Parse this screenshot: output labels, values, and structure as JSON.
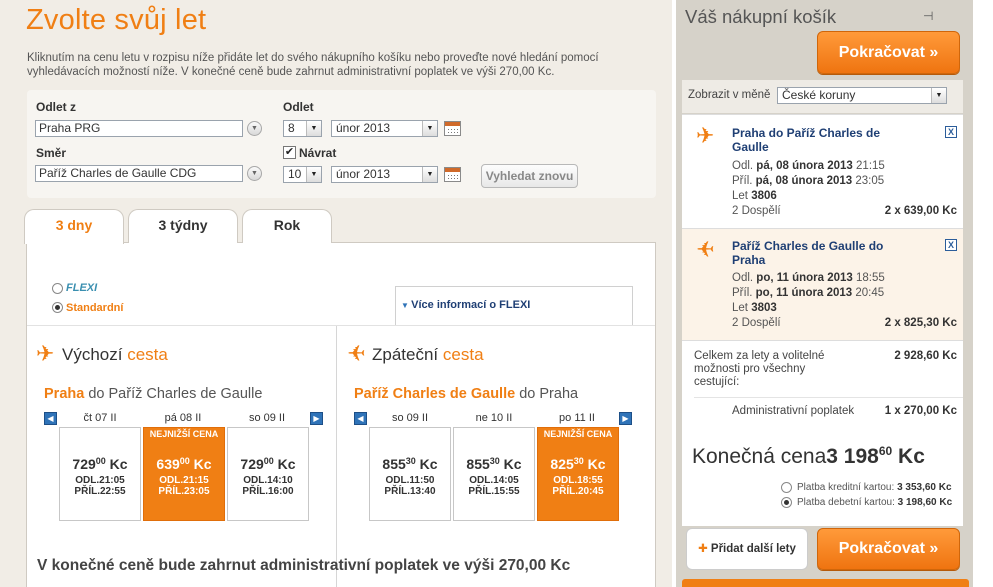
{
  "page": {
    "title": "Zvolte svůj let",
    "intro_line1": "Kliknutím na cenu letu v rozpisu níže přidáte let do svého nákupního košíku nebo proveďte nové hledání pomocí",
    "intro_line2": "vyhledávacích možností níže. V konečné ceně bude zahrnut administrativní poplatek ve výši 270,00 Kc."
  },
  "search": {
    "departure_label": "Odlet z",
    "departure_value": "Praha PRG",
    "destination_label": "Směr",
    "destination_value": "Paříž Charles de Gaulle CDG",
    "outbound_label": "Odlet",
    "outbound_day": "8",
    "outbound_month": "únor 2013",
    "return_checkbox_label": "Návrat",
    "return_checked": true,
    "return_day": "10",
    "return_month": "únor 2013",
    "search_again_label": "Vyhledat znovu"
  },
  "tabs": [
    {
      "label": "3 dny",
      "active": true
    },
    {
      "label": "3 týdny",
      "active": false
    },
    {
      "label": "Rok",
      "active": false
    }
  ],
  "fare": {
    "flexi_label": "FLEXI",
    "standard_label": "Standardní",
    "selected": "standard",
    "more_info_label": "Více informací o FLEXI"
  },
  "outbound": {
    "title_main": "Výchozí",
    "title_hl": "cesta",
    "route_from": "Praha",
    "route_to": "do Paříž Charles de Gaulle",
    "days": [
      {
        "label": "čt 07 II",
        "price_int": "729",
        "price_dec": "00",
        "currency": "Kc",
        "dep": "ODL.21:05",
        "arr": "PŘÍL.22:55",
        "selected": false,
        "badge": ""
      },
      {
        "label": "pá 08 II",
        "price_int": "639",
        "price_dec": "00",
        "currency": "Kc",
        "dep": "ODL.21:15",
        "arr": "PŘÍL.23:05",
        "selected": true,
        "badge": "NEJNIŽŠÍ CENA"
      },
      {
        "label": "so 09 II",
        "price_int": "729",
        "price_dec": "00",
        "currency": "Kc",
        "dep": "ODL.14:10",
        "arr": "PŘÍL.16:00",
        "selected": false,
        "badge": ""
      }
    ]
  },
  "return": {
    "title_main": "Zpáteční",
    "title_hl": "cesta",
    "route_from": "Paříž Charles de Gaulle",
    "route_to": "do Praha",
    "days": [
      {
        "label": "so 09 II",
        "price_int": "855",
        "price_dec": "30",
        "currency": "Kc",
        "dep": "ODL.11:50",
        "arr": "PŘÍL.13:40",
        "selected": false,
        "badge": ""
      },
      {
        "label": "ne 10 II",
        "price_int": "855",
        "price_dec": "30",
        "currency": "Kc",
        "dep": "ODL.14:05",
        "arr": "PŘÍL.15:55",
        "selected": false,
        "badge": ""
      },
      {
        "label": "po 11 II",
        "price_int": "825",
        "price_dec": "30",
        "currency": "Kc",
        "dep": "ODL.18:55",
        "arr": "PŘÍL.20:45",
        "selected": true,
        "badge": "NEJNIŽŠÍ CENA"
      }
    ]
  },
  "bottom_note": "V konečné ceně bude zahrnut administrativní poplatek ve výši 270,00 Kc",
  "cart": {
    "title": "Váš nákupní košík",
    "continue_label": "Pokračovat",
    "currency_label": "Zobrazit v měně",
    "currency_value": "České koruny",
    "legs": [
      {
        "route_line1": "Praha do Paříž Charles de",
        "route_line2": "Gaulle",
        "dep_prefix": "Odl.",
        "dep_value": "pá, 08 února 2013",
        "dep_time": "21:15",
        "arr_prefix": "Příl.",
        "arr_value": "pá, 08 února 2013",
        "arr_time": "23:05",
        "flight_prefix": "Let",
        "flight_no": "3806",
        "pax": "2 Dospělí",
        "price": "2 x 639,00 Kc"
      },
      {
        "route_line1": "Paříž Charles de Gaulle do",
        "route_line2": "Praha",
        "dep_prefix": "Odl.",
        "dep_value": "po, 11 února 2013",
        "dep_time": "18:55",
        "arr_prefix": "Příl.",
        "arr_value": "po, 11 února 2013",
        "arr_time": "20:45",
        "flight_prefix": "Let",
        "flight_no": "3803",
        "pax": "2 Dospělí",
        "price": "2 x 825,30 Kc"
      }
    ],
    "total_label_l1": "Celkem za lety a volitelné",
    "total_label_l2": "možnosti pro všechny",
    "total_label_l3": "cestující:",
    "total_value": "2 928,60 Kc",
    "admin_label": "Administrativní poplatek",
    "admin_value": "1 x 270,00 Kc",
    "final_label": "Konečná cena",
    "final_int": "3 198",
    "final_dec": "60",
    "final_currency": "Kc",
    "pay_credit_label": "Platba kreditní kartou:",
    "pay_credit_value": "3 353,60 Kc",
    "pay_debit_label": "Platba debetní kartou:",
    "pay_debit_value": "3 198,60 Kc",
    "pay_selected": "debit",
    "add_flight_label": "Přidat další lety"
  },
  "colors": {
    "accent": "#f07f14",
    "link": "#1f3f74",
    "panel": "#d6d2c9"
  }
}
